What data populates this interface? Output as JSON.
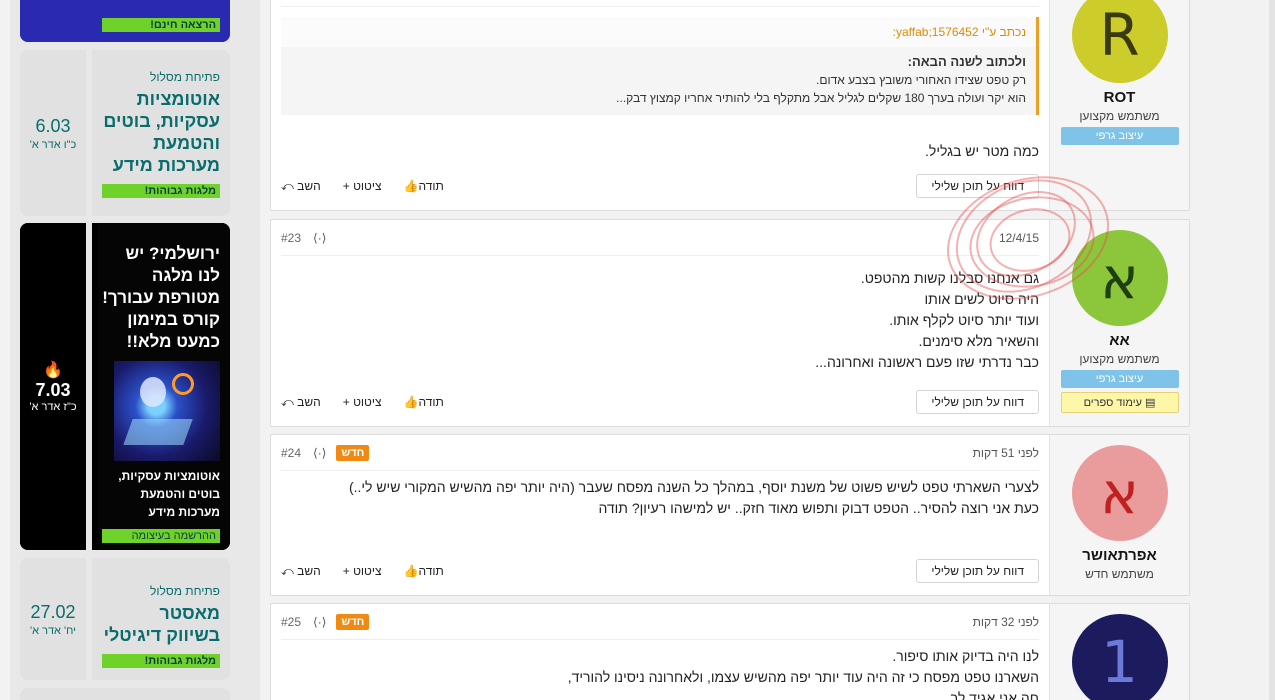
{
  "sidebar": {
    "ad_top": {
      "tag": "הרצאה חינם!"
    },
    "ad1": {
      "kicker": "פתיחת מסלול",
      "title": "אוטומציות עסקיות, בוטים והטמעת מערכות מידע",
      "tag": "מלגות גבוהות!",
      "day": "6.03",
      "hebdate": "כ\"ו אדר א'"
    },
    "ad2": {
      "title": "ירושלמי? יש לנו מלגה מטורפת עבורך! קורס במימון כמעט מלא!!",
      "sub": "אוטומציות עסקיות, בוטים והטמעת מערכות מידע",
      "tag": "ההרשמה בעיצומה",
      "day": "7.03",
      "hebdate": "כ\"ז אדר א'"
    },
    "ad3": {
      "kicker": "פתיחת מסלול",
      "title": "מאסטר בשיווק דיגיטלי",
      "tag": "מלגות גבוהות!",
      "day": "27.02",
      "hebdate": "יח' אדר א'"
    }
  },
  "posts": [
    {
      "user": {
        "avatar": "R",
        "name": "ROT",
        "title": "משתמש מקצוען",
        "badges": [
          "עיצוב גרפי"
        ]
      },
      "quote": {
        "author": "נכתב ע\"י yaffab;1576452:",
        "bold": "ולכתוב לשנה הבאה:",
        "lines": [
          "רק טפט שצידו האחורי משובץ בצבע אדום.",
          "הוא יקר ועולה בערך 180 שקלים לגליל אבל מתקלף בלי להותיר אחריו קמצוץ דבק..."
        ]
      },
      "lines": [
        "כמה מטר יש בגליל."
      ],
      "actions": {
        "reply": "השב",
        "quote": "ציטוט",
        "thanks": "תודה",
        "report": "דווח על תוכן שלילי"
      }
    },
    {
      "date": "12/4/15",
      "num": "#23",
      "user": {
        "avatar": "א",
        "name": "אא",
        "title": "משתמש מקצוען",
        "badges": [
          "עיצוב גרפי",
          "עימוד ספרים"
        ]
      },
      "lines": [
        "גם אנחנו סבלנו קשות מהטפט.",
        "היה סיוט לשים אותו",
        "ועוד יותר סיוט לקלף אותו.",
        "והשאיר מלא סימנים.",
        "כבר נדרתי שזו פעם ראשונה ואחרונה..."
      ],
      "actions": {
        "reply": "השב",
        "quote": "ציטוט",
        "thanks": "תודה",
        "report": "דווח על תוכן שלילי"
      }
    },
    {
      "date": "לפני 51 דקות",
      "new": "חדש",
      "num": "#24",
      "user": {
        "avatar": "א",
        "name": "אפרתאושר",
        "title": "משתמש חדש"
      },
      "lines": [
        "לצערי השארתי טפט לשיש פשוט של משנת יוסף, במהלך כל השנה מפסח שעבר (היה יותר יפה מהשיש המקורי שיש לי..)",
        "כעת אני רוצה להסיר.. הטפט דבוק ותפוש מאוד חזק.. יש למישהו רעיון? תודה"
      ],
      "actions": {
        "reply": "השב",
        "quote": "ציטוט",
        "thanks": "תודה",
        "report": "דווח על תוכן שלילי"
      }
    },
    {
      "date": "לפני 32 דקות",
      "new": "חדש",
      "num": "#25",
      "user": {
        "avatar": "1"
      },
      "lines": [
        "לנו היה בדיוק אותו סיפור.",
        "השארנו טפט מפסח כי זה היה עוד יותר יפה מהשיש עצמו, ולאחרונה ניסינו להוריד,",
        "חה אני אגיד לך..."
      ]
    }
  ],
  "colors": {
    "avatar_r": "#cccc2a",
    "avatar_a1": "#8cc63a",
    "avatar_a2": "#ea9c9c",
    "avatar_1": "#1b1b5e",
    "accent": "#0a6d6d",
    "new": "#f08a12"
  }
}
